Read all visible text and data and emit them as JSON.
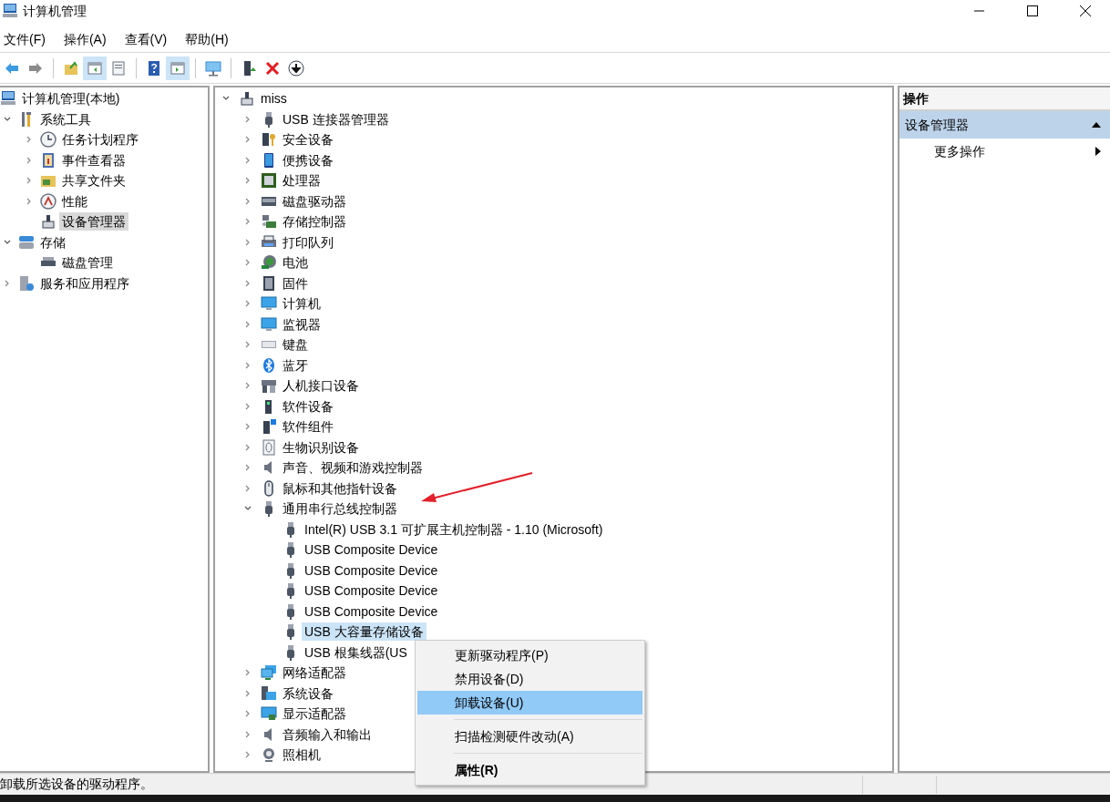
{
  "window": {
    "title": "计算机管理"
  },
  "menu": [
    "文件(F)",
    "操作(A)",
    "查看(V)",
    "帮助(H)"
  ],
  "toolbar": [
    {
      "pressed": false
    },
    {
      "pressed": false
    },
    {
      "pressed": false
    },
    {
      "pressed": true
    },
    {
      "pressed": false
    },
    {
      "pressed": false
    },
    {
      "pressed": true
    },
    {
      "pressed": false
    },
    {
      "pressed": false
    },
    {
      "pressed": false
    },
    {
      "pressed": false
    }
  ],
  "console_tree": [
    {
      "label": "计算机管理(本地)",
      "selected": false,
      "children": [
        {
          "label": "系统工具",
          "expanded": true,
          "selected": false,
          "children": [
            {
              "label": "任务计划程序",
              "expanded": false,
              "selected": false
            },
            {
              "label": "事件查看器",
              "expanded": false,
              "selected": false
            },
            {
              "label": "共享文件夹",
              "expanded": false,
              "selected": false
            },
            {
              "label": "性能",
              "expanded": false,
              "selected": false
            },
            {
              "label": "设备管理器",
              "selected": true
            }
          ]
        },
        {
          "label": "存储",
          "expanded": true,
          "selected": false,
          "children": [
            {
              "label": "磁盘管理",
              "selected": false
            }
          ]
        },
        {
          "label": "服务和应用程序",
          "expanded": false,
          "selected": false
        }
      ]
    }
  ],
  "device_tree": {
    "label": "miss",
    "expanded": true,
    "children": [
      {
        "label": "USB 连接器管理器",
        "expanded": false,
        "selected": false
      },
      {
        "label": "安全设备",
        "expanded": false,
        "selected": false
      },
      {
        "label": "便携设备",
        "expanded": false,
        "selected": false
      },
      {
        "label": "处理器",
        "expanded": false,
        "selected": false
      },
      {
        "label": "磁盘驱动器",
        "expanded": false,
        "selected": false
      },
      {
        "label": "存储控制器",
        "expanded": false,
        "selected": false
      },
      {
        "label": "打印队列",
        "expanded": false,
        "selected": false
      },
      {
        "label": "电池",
        "expanded": false,
        "selected": false
      },
      {
        "label": "固件",
        "expanded": false,
        "selected": false
      },
      {
        "label": "计算机",
        "expanded": false,
        "selected": false
      },
      {
        "label": "监视器",
        "expanded": false,
        "selected": false
      },
      {
        "label": "键盘",
        "expanded": false,
        "selected": false
      },
      {
        "label": "蓝牙",
        "expanded": false,
        "selected": false
      },
      {
        "label": "人机接口设备",
        "expanded": false,
        "selected": false
      },
      {
        "label": "软件设备",
        "expanded": false,
        "selected": false
      },
      {
        "label": "软件组件",
        "expanded": false,
        "selected": false
      },
      {
        "label": "生物识别设备",
        "expanded": false,
        "selected": false
      },
      {
        "label": "声音、视频和游戏控制器",
        "expanded": false,
        "selected": false
      },
      {
        "label": "鼠标和其他指针设备",
        "expanded": false,
        "selected": false
      },
      {
        "label": "通用串行总线控制器",
        "expanded": true,
        "selected": false,
        "children": [
          {
            "label": "Intel(R) USB 3.1 可扩展主机控制器 - 1.10 (Microsoft)",
            "selected": false
          },
          {
            "label": "USB Composite Device",
            "selected": false
          },
          {
            "label": "USB Composite Device",
            "selected": false
          },
          {
            "label": "USB Composite Device",
            "selected": false
          },
          {
            "label": "USB Composite Device",
            "selected": false
          },
          {
            "label": "USB 大容量存储设备",
            "selected": true
          },
          {
            "label": "USB 根集线器(US",
            "selected": false
          }
        ]
      },
      {
        "label": "网络适配器",
        "expanded": false,
        "selected": false
      },
      {
        "label": "系统设备",
        "expanded": false,
        "selected": false
      },
      {
        "label": "显示适配器",
        "expanded": false,
        "selected": false
      },
      {
        "label": "音频输入和输出",
        "expanded": false,
        "selected": false
      },
      {
        "label": "照相机",
        "expanded": false,
        "selected": false
      }
    ]
  },
  "context_menu": [
    {
      "label": "更新驱动程序(P)",
      "selected": false,
      "separator_before": false,
      "kind": "normal"
    },
    {
      "label": "禁用设备(D)",
      "selected": false,
      "separator_before": false,
      "kind": "normal"
    },
    {
      "label": "卸载设备(U)",
      "selected": true,
      "separator_before": false,
      "kind": "normal"
    },
    {
      "label": "扫描检测硬件改动(A)",
      "selected": false,
      "separator_before": true,
      "kind": "normal"
    },
    {
      "label": "属性(R)",
      "selected": false,
      "separator_before": true,
      "kind": "default"
    }
  ],
  "actions_pane": {
    "title": "操作",
    "section": {
      "label": "设备管理器",
      "expanded": true
    },
    "items": [
      "更多操作"
    ]
  },
  "status_bar": "卸载所选设备的驱动程序。"
}
